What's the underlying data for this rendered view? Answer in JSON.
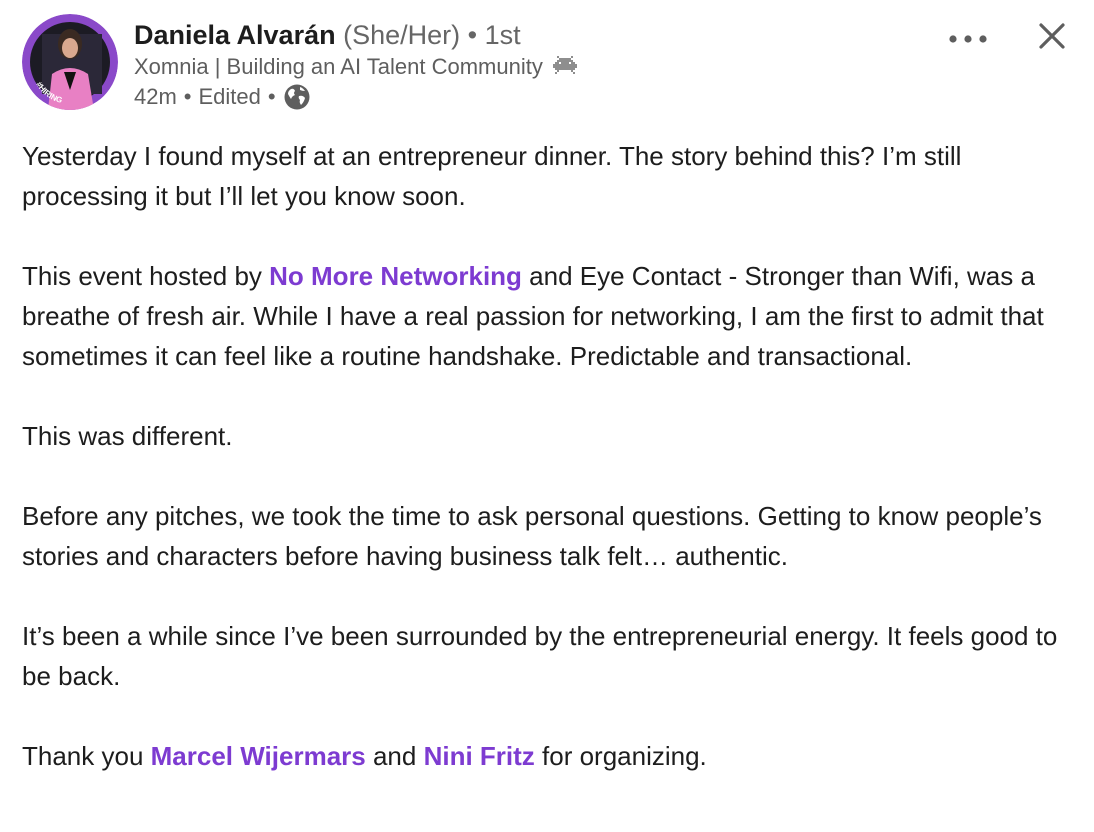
{
  "author": {
    "name": "Daniela Alvarán",
    "pronouns": "(She/Her)",
    "separator": "•",
    "degree": "1st",
    "headline": "Xomnia | Building an AI Talent Community",
    "avatar_badge": "#HIRING"
  },
  "meta": {
    "time": "42m",
    "separator": "•",
    "edited": "Edited",
    "visibility_icon": "globe-icon"
  },
  "actions": {
    "more_icon": "more-horizontal-icon",
    "close_icon": "close-icon"
  },
  "post": {
    "p1": "Yesterday I found myself at an entrepreneur dinner. The story behind this? I’m still processing it but I’ll let you know soon.",
    "p2_before": "This event hosted by ",
    "p2_mention": "No More Networking",
    "p2_after": " and Eye Contact - Stronger than Wifi, was a breathe of fresh air. While I have a real passion for networking, I am the first to admit that sometimes it can feel like a routine handshake. Predictable and transactional.",
    "p3": "This was different.",
    "p4": "Before any pitches, we took the time to ask personal questions. Getting to know people’s stories and characters before having business talk felt… authentic.",
    "p5": "It’s been a while since I’ve been surrounded by the entrepreneurial energy. It feels good to be back.",
    "p6_before": "Thank you ",
    "p6_mention1": "Marcel Wijermars",
    "p6_middle": " and ",
    "p6_mention2": "Nini Fritz",
    "p6_after": " for organizing."
  },
  "colors": {
    "mention": "#7d3bd1",
    "hiring_frame": "#8a49c9",
    "text": "#1d1d1d",
    "secondary": "#5e5e5e"
  }
}
